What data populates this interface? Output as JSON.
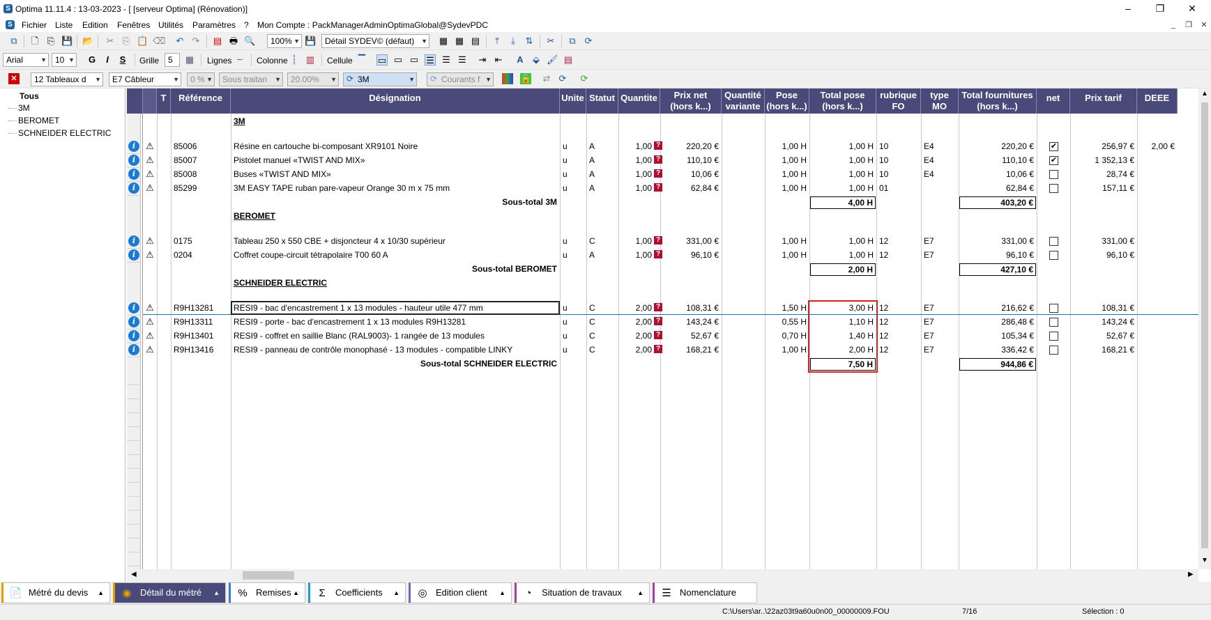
{
  "window": {
    "title": "Optima 11.11.4 : 13-03-2023 - [ [serveur Optima] (Rénovation)]"
  },
  "menu": [
    "Fichier",
    "Liste",
    "Edition",
    "Fenêtres",
    "Utilités",
    "Paramètres",
    "?",
    "Mon Compte : PackManagerAdminOptimaGlobal@SydevPDC"
  ],
  "toolbar1": {
    "zoom": "100%",
    "view": "Détail  SYDEV© (défaut)"
  },
  "toolbar2": {
    "font": "Arial",
    "size": "10",
    "grille_label": "Grille",
    "grille_value": "5",
    "lignes_label": "Lignes",
    "colonne_label": "Colonne",
    "cellule_label": "Cellule"
  },
  "toolbar3": {
    "combo1": "12  Tableaux d",
    "combo2": "E7  Câbleur",
    "combo3": "0 %",
    "combo4": "Sous traitan",
    "combo5": "20.00%",
    "combo6": "3M",
    "combo7": "Courants f"
  },
  "tree": [
    "Tous",
    "3M",
    "BEROMET",
    "SCHNEIDER ELECTRIC"
  ],
  "columns": {
    "t": "T",
    "ref": "Référence",
    "des": "Désignation",
    "unite": "Unite",
    "statut": "Statut",
    "qte": "Quantite",
    "prixnet": [
      "Prix net",
      "(hors k...)"
    ],
    "qtevar": [
      "Quantité",
      "variante"
    ],
    "pose": [
      "Pose",
      "(hors k...)"
    ],
    "totpose": [
      "Total pose",
      "(hors k...)"
    ],
    "rubfo": [
      "rubrique",
      "FO"
    ],
    "typemo": [
      "type",
      "MO"
    ],
    "totfourn": [
      "Total fournitures",
      "(hors k...)"
    ],
    "net": "net",
    "prixtarif": "Prix tarif",
    "deee": "DEEE"
  },
  "groups": [
    {
      "name": "3M",
      "subtotal_label": "Sous-total 3M",
      "subtotal_pose": "4,00 H",
      "subtotal_fourn": "403,20 €",
      "rows": [
        {
          "ref": "85006",
          "des": "Résine en cartouche bi-composant XR9101 Noire",
          "unite": "u",
          "statut": "A",
          "qte": "1,00",
          "prixnet": "220,20 €",
          "pose": "1,00 H",
          "totpose": "1,00 H",
          "rubfo": "10",
          "typemo": "E4",
          "totfourn": "220,20 €",
          "net": true,
          "prixtarif": "256,97 €",
          "deee": "2,00 €"
        },
        {
          "ref": "85007",
          "des": "Pistolet manuel «TWIST AND MIX»",
          "unite": "u",
          "statut": "A",
          "qte": "1,00",
          "prixnet": "110,10 €",
          "pose": "1,00 H",
          "totpose": "1,00 H",
          "rubfo": "10",
          "typemo": "E4",
          "totfourn": "110,10 €",
          "net": true,
          "prixtarif": "1 352,13 €",
          "deee": ""
        },
        {
          "ref": "85008",
          "des": "Buses «TWIST AND MIX»",
          "unite": "u",
          "statut": "A",
          "qte": "1,00",
          "prixnet": "10,06 €",
          "pose": "1,00 H",
          "totpose": "1,00 H",
          "rubfo": "10",
          "typemo": "E4",
          "totfourn": "10,06 €",
          "net": false,
          "prixtarif": "28,74 €",
          "deee": ""
        },
        {
          "ref": "85299",
          "des": "3M EASY TAPE ruban pare-vapeur Orange 30 m x 75 mm",
          "unite": "u",
          "statut": "A",
          "qte": "1,00",
          "prixnet": "62,84 €",
          "pose": "1,00 H",
          "totpose": "1,00 H",
          "rubfo": "01",
          "typemo": "",
          "totfourn": "62,84 €",
          "net": false,
          "prixtarif": "157,11 €",
          "deee": ""
        }
      ]
    },
    {
      "name": "BEROMET",
      "subtotal_label": "Sous-total BEROMET",
      "subtotal_pose": "2,00 H",
      "subtotal_fourn": "427,10 €",
      "rows": [
        {
          "ref": "0175",
          "des": "Tableau 250 x 550 CBE + disjoncteur 4 x 10/30 supérieur",
          "unite": "u",
          "statut": "C",
          "qte": "1,00",
          "prixnet": "331,00 €",
          "pose": "1,00 H",
          "totpose": "1,00 H",
          "rubfo": "12",
          "typemo": "E7",
          "totfourn": "331,00 €",
          "net": false,
          "prixtarif": "331,00 €",
          "deee": ""
        },
        {
          "ref": "0204",
          "des": "Coffret coupe-circuit tétrapolaire T00 60 A",
          "unite": "u",
          "statut": "A",
          "qte": "1,00",
          "prixnet": "96,10 €",
          "pose": "1,00 H",
          "totpose": "1,00 H",
          "rubfo": "12",
          "typemo": "E7",
          "totfourn": "96,10 €",
          "net": false,
          "prixtarif": "96,10 €",
          "deee": ""
        }
      ]
    },
    {
      "name": "SCHNEIDER ELECTRIC",
      "subtotal_label": "Sous-total SCHNEIDER ELECTRIC",
      "subtotal_pose": "7,50 H",
      "subtotal_fourn": "944,86 €",
      "rows": [
        {
          "ref": "R9H13281",
          "des": "RESI9 - bac d'encastrement 1 x 13 modules - hauteur utile 477 mm",
          "unite": "u",
          "statut": "C",
          "qte": "2,00",
          "prixnet": "108,31 €",
          "pose": "1,50 H",
          "totpose": "3,00 H",
          "rubfo": "12",
          "typemo": "E7",
          "totfourn": "216,62 €",
          "net": false,
          "prixtarif": "108,31 €",
          "deee": ""
        },
        {
          "ref": "R9H13311",
          "des": "RESI9 - porte - bac d'encastrement 1 x 13 modules R9H13281",
          "unite": "u",
          "statut": "C",
          "qte": "2,00",
          "prixnet": "143,24 €",
          "pose": "0,55 H",
          "totpose": "1,10 H",
          "rubfo": "12",
          "typemo": "E7",
          "totfourn": "286,48 €",
          "net": false,
          "prixtarif": "143,24 €",
          "deee": ""
        },
        {
          "ref": "R9H13401",
          "des": "RESI9 - coffret en saillie Blanc (RAL9003)- 1 rangée de 13 modules",
          "unite": "u",
          "statut": "C",
          "qte": "2,00",
          "prixnet": "52,67 €",
          "pose": "0,70 H",
          "totpose": "1,40 H",
          "rubfo": "12",
          "typemo": "E7",
          "totfourn": "105,34 €",
          "net": false,
          "prixtarif": "52,67 €",
          "deee": ""
        },
        {
          "ref": "R9H13416",
          "des": "RESI9 - panneau de contrôle monophasé - 13 modules - compatible LINKY",
          "unite": "u",
          "statut": "C",
          "qte": "2,00",
          "prixnet": "168,21 €",
          "pose": "1,00 H",
          "totpose": "2,00 H",
          "rubfo": "12",
          "typemo": "E7",
          "totfourn": "336,42 €",
          "net": false,
          "prixtarif": "168,21 €",
          "deee": ""
        }
      ]
    }
  ],
  "tabs": [
    "Métré du devis",
    "Détail du métré",
    "Remises",
    "Coefficients",
    "Edition client",
    "Situation de travaux",
    "Nomenclature"
  ],
  "status": {
    "path": "C:\\Users\\ar..\\22az03t9a60u0n00_00000009.FOU",
    "page": "7/16",
    "selection": "Sélection : 0"
  }
}
